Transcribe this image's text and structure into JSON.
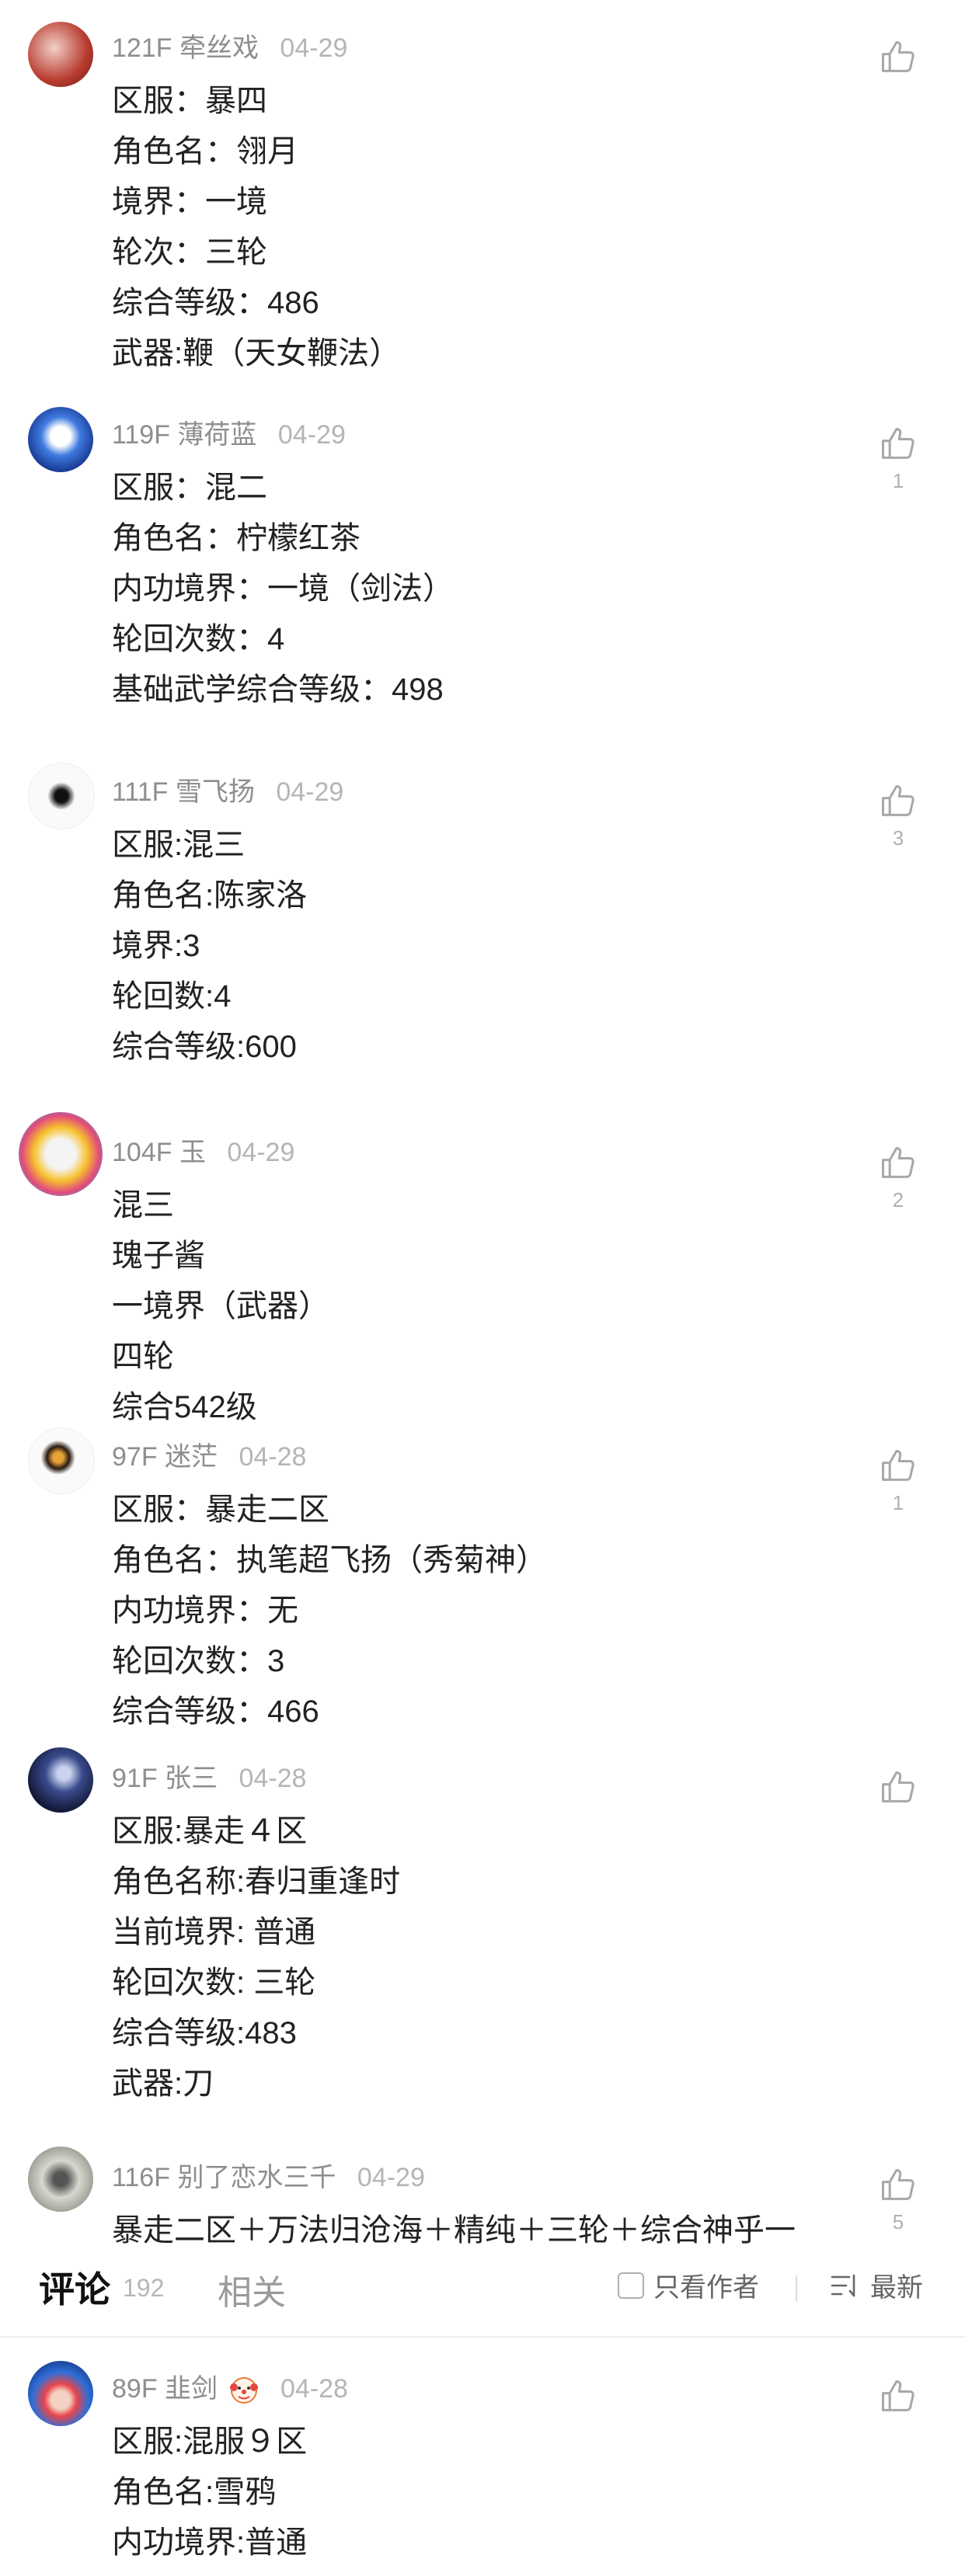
{
  "comments": [
    {
      "floor": "121F",
      "name": "牵丝戏",
      "date": "04-29",
      "likes": "",
      "lines": [
        "区服：暴四",
        "角色名：翎月",
        "境界：一境",
        "轮次：三轮",
        "综合等级：486",
        "武器:鞭（天女鞭法）"
      ]
    },
    {
      "floor": "119F",
      "name": "薄荷蓝",
      "date": "04-29",
      "likes": "1",
      "lines": [
        "区服：混二",
        "角色名：柠檬红茶",
        "内功境界：一境（剑法）",
        "轮回次数：4",
        "基础武学综合等级：498"
      ]
    },
    {
      "floor": "111F",
      "name": "雪飞扬",
      "date": "04-29",
      "likes": "3",
      "lines": [
        "区服:混三",
        "角色名:陈家洛",
        "境界:3",
        "轮回数:4",
        "综合等级:600"
      ]
    },
    {
      "floor": "104F",
      "name": "玉",
      "date": "04-29",
      "likes": "2",
      "lines": [
        "混三",
        "瑰子酱",
        "一境界（武器）",
        "四轮",
        "综合542级"
      ]
    },
    {
      "floor": "97F",
      "name": "迷茫",
      "date": "04-28",
      "likes": "1",
      "lines": [
        "区服：暴走二区",
        "角色名：执笔超飞扬（秀菊神）",
        "内功境界：无",
        "轮回次数：3",
        "综合等级：466"
      ]
    },
    {
      "floor": "91F",
      "name": "张三",
      "date": "04-28",
      "likes": "",
      "lines": [
        "区服:暴走４区",
        "角色名称:春归重逢时",
        "当前境界: 普通",
        "轮回次数: 三轮",
        "综合等级:483",
        "武器:刀"
      ]
    },
    {
      "floor": "116F",
      "name": "别了恋水三千",
      "date": "04-29",
      "likes": "5",
      "lines": [
        "暴走二区＋万法归沧海＋精纯＋三轮＋综合神乎一"
      ]
    },
    {
      "floor": "89F",
      "name": "韭剑",
      "date": "04-28",
      "likes": "",
      "lines": [
        "区服:混服９区",
        "角色名:雪鸦",
        "内功境界:普通"
      ]
    }
  ],
  "tabbar": {
    "comments_tab": "评论",
    "comments_count": "192",
    "related_tab": "相关",
    "author_only": "只看作者",
    "sort": "最新"
  },
  "icons": {
    "like": "thumbs-up-icon",
    "sort": "sort-icon",
    "checkbox": "checkbox-icon",
    "emoji": "clown-emoji-icon"
  }
}
